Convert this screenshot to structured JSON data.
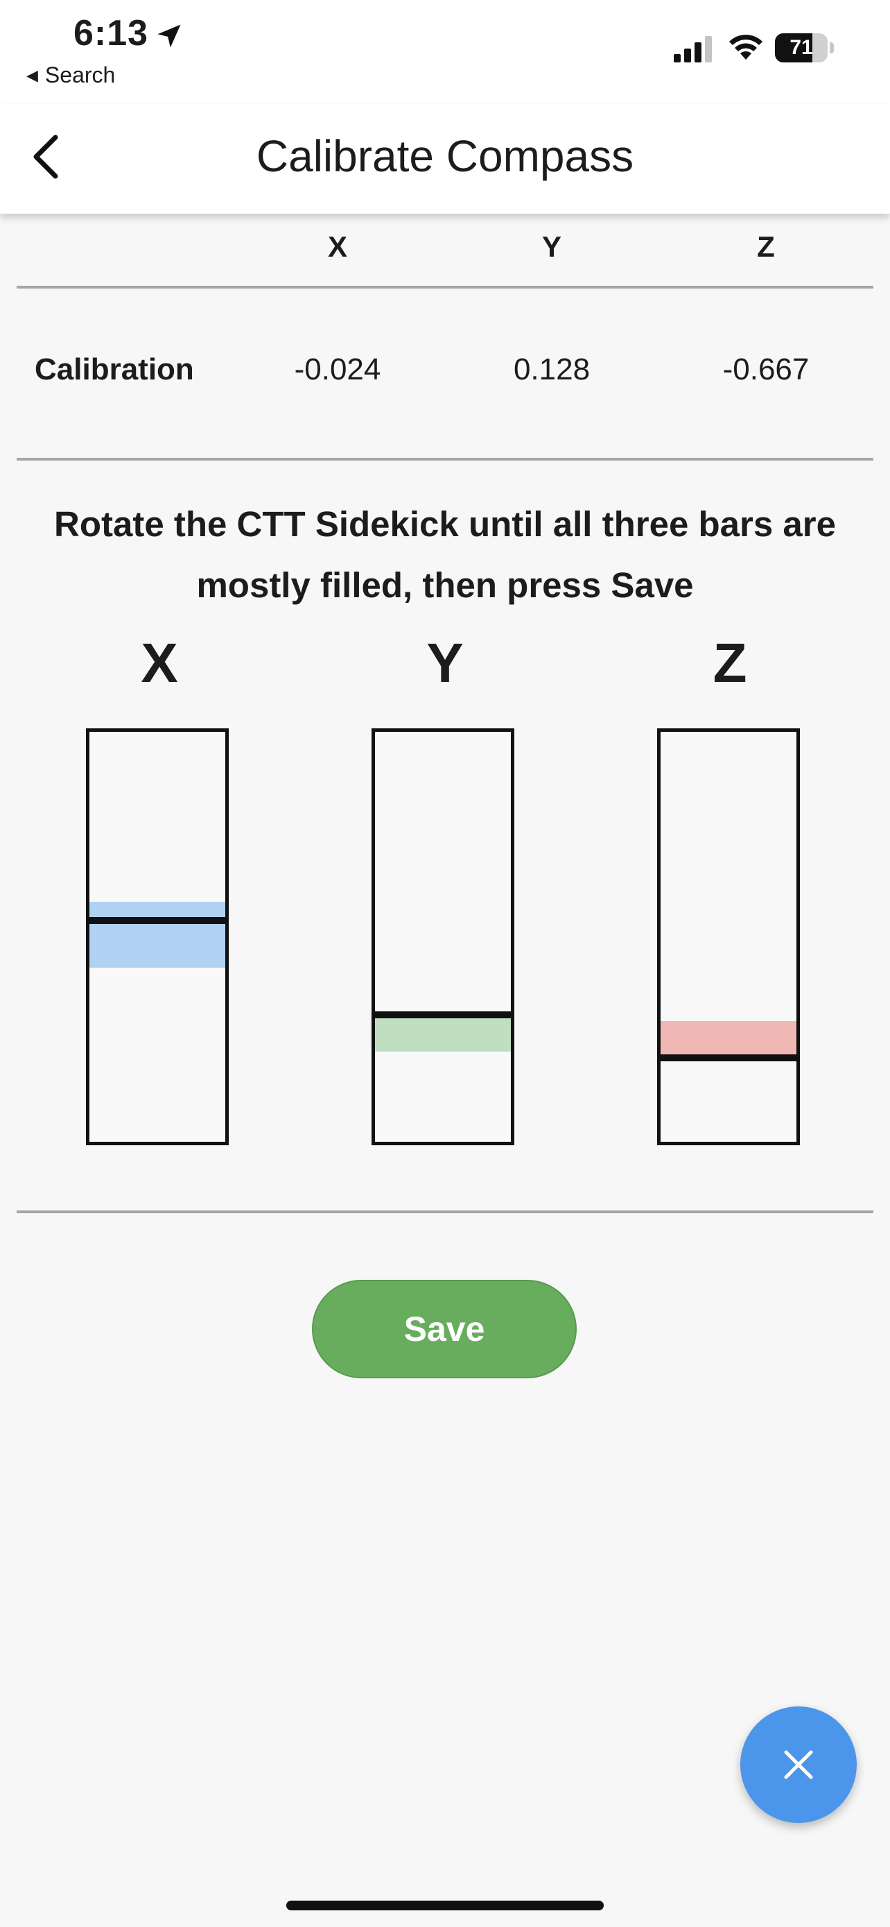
{
  "status_bar": {
    "time": "6:13",
    "back_app_label": "Search",
    "battery_percent": "71",
    "battery_level": 0.71
  },
  "header": {
    "title": "Calibrate Compass"
  },
  "calibration_table": {
    "columns": [
      "X",
      "Y",
      "Z"
    ],
    "row_label": "Calibration",
    "values": [
      "-0.024",
      "0.128",
      "-0.667"
    ]
  },
  "instruction": "Rotate the CTT Sidekick until all three bars are mostly filled, then press Save",
  "bars": [
    {
      "label": "X",
      "color": "#b1d1f3",
      "band_from": 0.415,
      "band_to": 0.575,
      "marker": 0.46
    },
    {
      "label": "Y",
      "color": "#c0dfc0",
      "band_from": 0.69,
      "band_to": 0.78,
      "marker": 0.69
    },
    {
      "label": "Z",
      "color": "#f0b8b4",
      "band_from": 0.705,
      "band_to": 0.795,
      "marker": 0.795
    }
  ],
  "actions": {
    "save_label": "Save"
  },
  "colors": {
    "save_green": "#67ad5d",
    "fab_blue": "#4b96ea"
  }
}
